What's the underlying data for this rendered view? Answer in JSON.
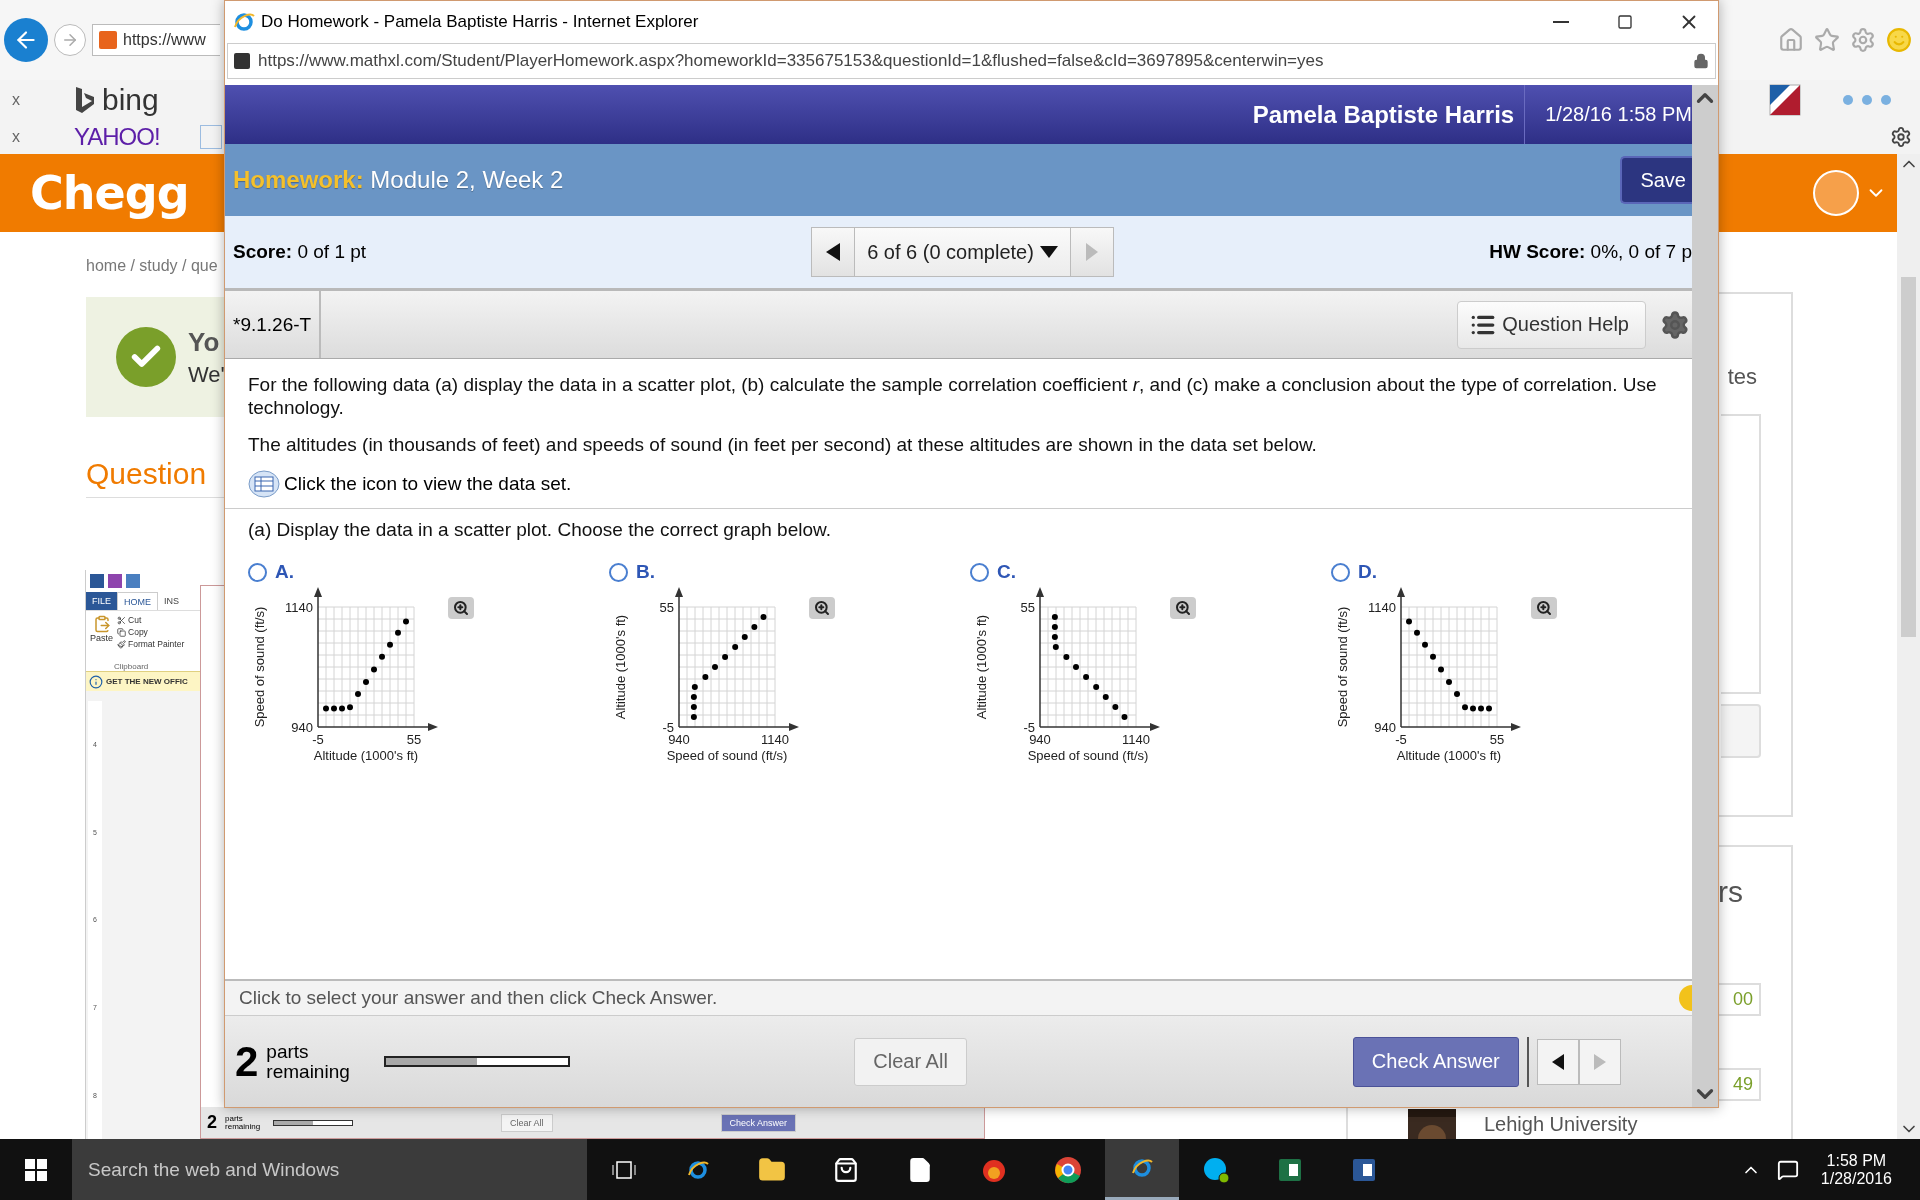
{
  "background_browser": {
    "address": "https://www",
    "favorites": [
      {
        "kind": "bing",
        "close": "x",
        "label": "bing"
      },
      {
        "kind": "yahoo",
        "close": "x",
        "label": "YAHOO!"
      }
    ],
    "brand": "Chegg",
    "breadcrumb": "home / study / que",
    "notice": {
      "title": "Yo",
      "text": "We'"
    },
    "section_heading": "Question",
    "side_card": {
      "heading": "tes"
    },
    "experts_card": {
      "heading": "rs",
      "badges": [
        "00",
        "49"
      ],
      "school": "Lehigh University"
    }
  },
  "word_window": {
    "tabs": [
      {
        "label": "FILE",
        "selected": false
      },
      {
        "label": "HOME",
        "selected": true
      },
      {
        "label": "INS",
        "selected": false
      }
    ],
    "paste": "Paste",
    "commands": [
      "Cut",
      "Copy",
      "Format Painter"
    ],
    "group": "Clipboard",
    "banner": "GET THE NEW OFFIC",
    "ruler": [
      "4",
      "5",
      "6",
      "7",
      "8"
    ],
    "preview": {
      "count": "2",
      "label": "parts remaining",
      "progress": {
        "level": 0.5
      },
      "clear": "Clear All",
      "check": "Check Answer"
    }
  },
  "popup": {
    "title": "Do Homework - Pamela Baptiste Harris - Internet Explorer",
    "url": "https://www.mathxl.com/Student/PlayerHomework.aspx?homeworkId=335675153&questionId=1&flushed=false&cId=3697895&centerwin=yes",
    "student": "Pamela Baptiste Harris",
    "datetime": "1/28/16 1:58 PM",
    "homework_label": "Homework:",
    "homework_name": "Module 2, Week 2",
    "save": "Save",
    "score_label": "Score:",
    "score_value": "0 of 1 pt",
    "navigator": "6 of 6 (0 complete)",
    "hw_score_label": "HW Score:",
    "hw_score_value": "0%, 0 of 7 p",
    "question_id": "*9.1.26-T",
    "question_help": "Question Help",
    "paragraphs": [
      "For the following data (a) display the data in a scatter plot, (b) calculate the sample correlation coefficient *r*, and (c) make a conclusion about the type of correlation. Use technology.",
      "The altitudes (in thousands of feet) and speeds of sound (in feet per second) at these altitudes are shown in the data set below."
    ],
    "data_link": "Click the icon to view the data set.",
    "part_prompt": "(a) Display the data in a scatter plot. Choose the correct graph below.",
    "options": [
      {
        "letter": "A.",
        "selected": false,
        "chart_data": {
          "type": "scatter",
          "xlabel": "Altitude (1000's ft)",
          "ylabel": "Speed of sound (ft/s)",
          "x": [
            0,
            5,
            10,
            15,
            20,
            25,
            30,
            35,
            40,
            45,
            50
          ],
          "series": [
            {
              "color": "#000000",
              "values": [
                971,
                971,
                971,
                973,
                995,
                1015,
                1036,
                1057,
                1077,
                1097,
                1116
              ]
            }
          ],
          "xlim": [
            -5,
            55
          ],
          "ylim": [
            940,
            1140
          ],
          "xticks": [
            -5,
            55
          ],
          "yticks": [
            940,
            1140
          ]
        }
      },
      {
        "letter": "B.",
        "selected": false,
        "chart_data": {
          "type": "scatter",
          "xlabel": "Speed of sound (ft/s)",
          "ylabel": "Altitude (1000's ft)",
          "x": [
            971,
            971,
            971,
            973,
            995,
            1015,
            1036,
            1057,
            1077,
            1097,
            1116
          ],
          "series": [
            {
              "color": "#000000",
              "values": [
                0,
                5,
                10,
                15,
                20,
                25,
                30,
                35,
                40,
                45,
                50
              ]
            }
          ],
          "xlim": [
            940,
            1140
          ],
          "ylim": [
            -5,
            55
          ],
          "xticks": [
            940,
            1140
          ],
          "yticks": [
            -5,
            55
          ]
        }
      },
      {
        "letter": "C.",
        "selected": false,
        "chart_data": {
          "type": "scatter",
          "xlabel": "Speed of sound (ft/s)",
          "ylabel": "Altitude (1000's ft)",
          "x": [
            971,
            971,
            971,
            973,
            995,
            1015,
            1036,
            1057,
            1077,
            1097,
            1116
          ],
          "series": [
            {
              "color": "#000000",
              "values": [
                50,
                45,
                40,
                35,
                30,
                25,
                20,
                15,
                10,
                5,
                0
              ]
            }
          ],
          "xlim": [
            940,
            1140
          ],
          "ylim": [
            -5,
            55
          ],
          "xticks": [
            940,
            1140
          ],
          "yticks": [
            -5,
            55
          ]
        }
      },
      {
        "letter": "D.",
        "selected": false,
        "chart_data": {
          "type": "scatter",
          "xlabel": "Altitude (1000's ft)",
          "ylabel": "Speed of sound (ft/s)",
          "x": [
            0,
            5,
            10,
            15,
            20,
            25,
            30,
            35,
            40,
            45,
            50
          ],
          "series": [
            {
              "color": "#000000",
              "values": [
                1116,
                1097,
                1077,
                1057,
                1036,
                1015,
                995,
                973,
                971,
                971,
                971
              ]
            }
          ],
          "xlim": [
            -5,
            55
          ],
          "ylim": [
            940,
            1140
          ],
          "xticks": [
            -5,
            55
          ],
          "yticks": [
            940,
            1140
          ]
        }
      }
    ],
    "instruction": "Click to select your answer and then click Check Answer.",
    "parts_count": "2",
    "parts_label": "parts remaining",
    "progress": {
      "level": 0.5
    },
    "clear_all": "Clear All",
    "check_answer": "Check Answer"
  },
  "taskbar": {
    "search_placeholder": "Search the web and Windows",
    "time": "1:58 PM",
    "date": "1/28/2016"
  }
}
